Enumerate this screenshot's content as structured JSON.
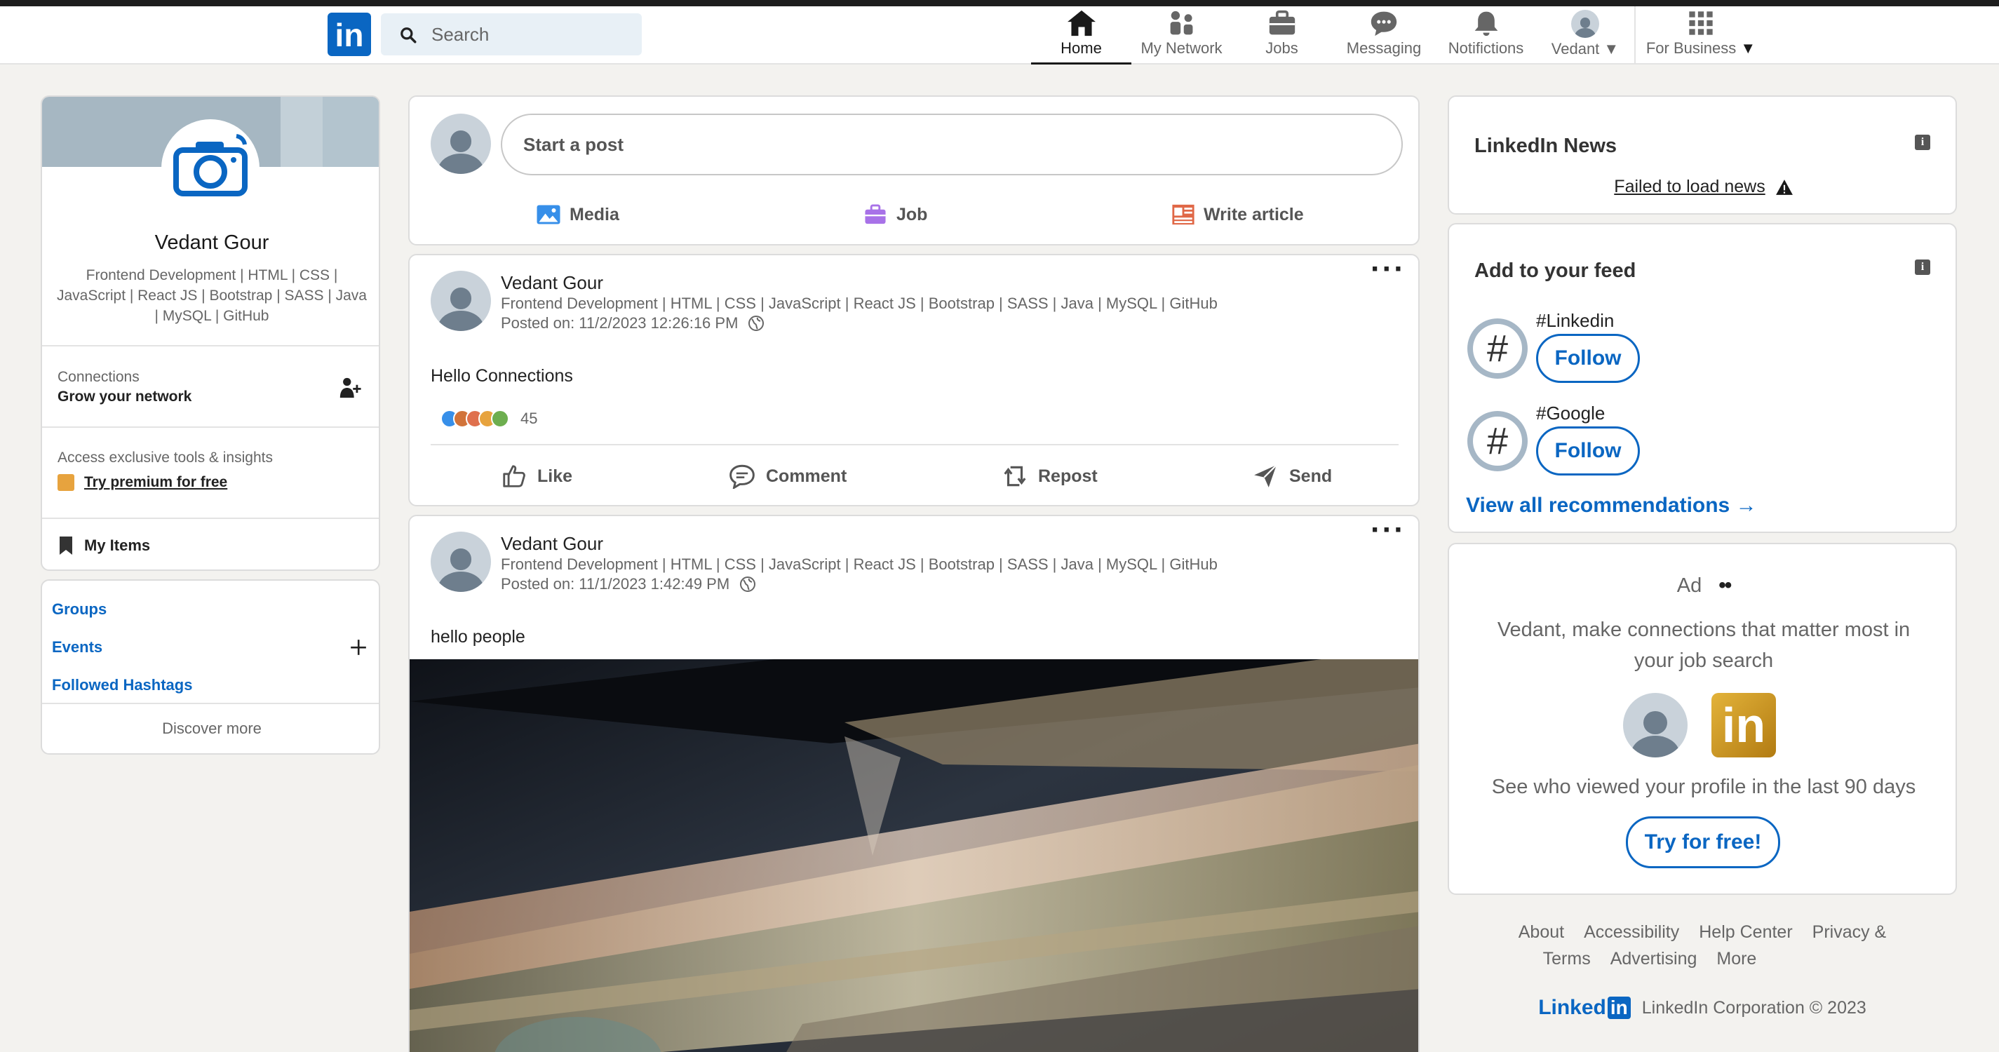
{
  "nav": {
    "logo_text": "in",
    "search_placeholder": "Search",
    "items": [
      {
        "label": "Home",
        "icon": "home-icon"
      },
      {
        "label": "My Network",
        "icon": "people-icon"
      },
      {
        "label": "Jobs",
        "icon": "briefcase-icon"
      },
      {
        "label": "Messaging",
        "icon": "chat-icon"
      },
      {
        "label": "Notifictions",
        "icon": "bell-icon"
      },
      {
        "label": "Vedant",
        "icon": "avatar-icon"
      },
      {
        "label": "For Business",
        "icon": "grid-icon"
      }
    ]
  },
  "profile": {
    "name": "Vedant Gour",
    "headline": "Frontend Development | HTML | CSS | JavaScript | React JS | Bootstrap | SASS | Java | MySQL | GitHub",
    "connections_label": "Connections",
    "connections_sub": "Grow your network",
    "premium_text": "Access exclusive tools & insights",
    "premium_link": "Try premium for free",
    "my_items": "My Items"
  },
  "links": {
    "groups": "Groups",
    "events": "Events",
    "hashtags": "Followed Hashtags",
    "discover": "Discover more"
  },
  "composer": {
    "placeholder": "Start a post",
    "media": "Media",
    "job": "Job",
    "article": "Write article"
  },
  "posts": [
    {
      "author": "Vedant Gour",
      "headline": "Frontend Development | HTML | CSS | JavaScript | React JS | Bootstrap | SASS | Java | MySQL | GitHub",
      "posted": "Posted on: 11/2/2023 12:26:16 PM",
      "text": "Hello Connections",
      "reactions": "45"
    },
    {
      "author": "Vedant Gour",
      "headline": "Frontend Development | HTML | CSS | JavaScript | React JS | Bootstrap | SASS | Java | MySQL | GitHub",
      "posted": "Posted on: 11/1/2023 1:42:49 PM",
      "text": "hello people"
    }
  ],
  "post_actions": {
    "like": "Like",
    "comment": "Comment",
    "repost": "Repost",
    "send": "Send"
  },
  "news": {
    "title": "LinkedIn News",
    "error": "Failed to load news"
  },
  "feed": {
    "title": "Add to your feed",
    "items": [
      {
        "tag": "#Linkedin",
        "btn": "Follow"
      },
      {
        "tag": "#Google",
        "btn": "Follow"
      }
    ],
    "view_all": "View all recommendations →"
  },
  "ad": {
    "label": "Ad",
    "headline": "Vedant, make connections that matter most in your job search",
    "sub": "See who viewed your profile in the last 90 days",
    "cta": "Try for free!",
    "badge_text": "in"
  },
  "footer": {
    "links": [
      "About",
      "Accessibility",
      "Help Center",
      "Privacy &",
      "Terms",
      "Advertising",
      "More"
    ],
    "brand_text": "Linked",
    "brand_in": "in",
    "copyright": "LinkedIn Corporation © 2023"
  },
  "colors": {
    "brand": "#0a66c2",
    "background": "#f3f2ef"
  }
}
